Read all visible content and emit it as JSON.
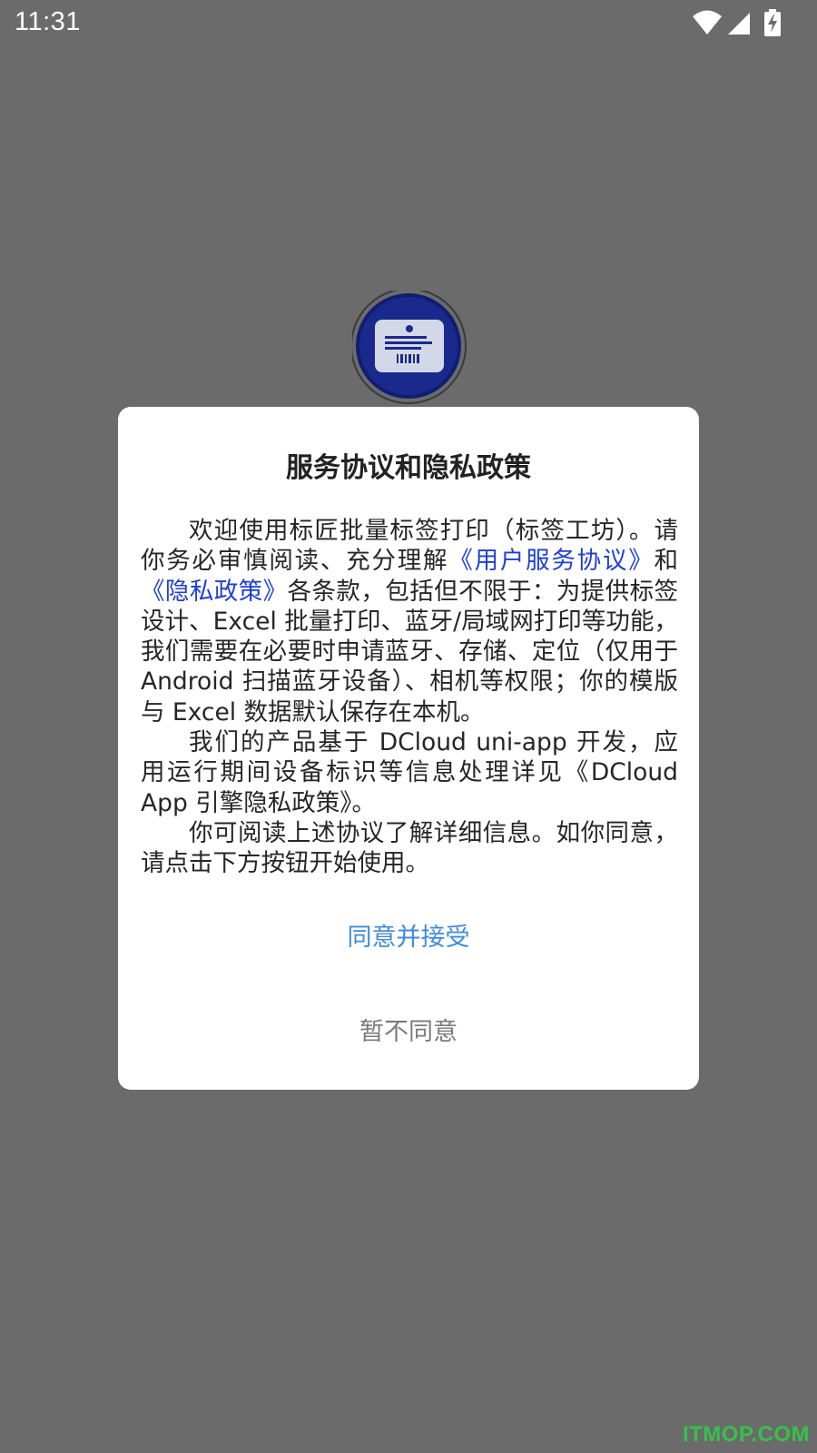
{
  "status_bar": {
    "time": "11:31",
    "icons": [
      "wifi-icon",
      "cell-signal-icon",
      "battery-charging-icon"
    ]
  },
  "app_logo": {
    "icon": "barcode-label-icon",
    "colors": {
      "ring": "#1a2a8c",
      "card": "#cfd5e6"
    }
  },
  "dialog": {
    "title": "服务协议和隐私政策",
    "paragraph1": {
      "text1": "欢迎使用标匠批量标签打印（标签工坊）。请你务必审慎阅读、充分理解",
      "link1": "《用户服务协议》",
      "text2": "和",
      "link2": "《隐私政策》",
      "text3": "各条款，包括但不限于：为提供标签设计、Excel 批量打印、蓝牙/局域网打印等功能，我们需要在必要时申请蓝牙、存储、定位（仅用于 Android 扫描蓝牙设备）、相机等权限；你的模版与 Excel 数据默认保存在本机。"
    },
    "paragraph2": "我们的产品基于 DCloud uni-app 开发，应用运行期间设备标识等信息处理详见《DCloud App 引擎隐私政策》。",
    "paragraph3": "你可阅读上述协议了解详细信息。如你同意，请点击下方按钮开始使用。",
    "agree_label": "同意并接受",
    "disagree_label": "暂不同意",
    "colors": {
      "link": "#1e3fd8",
      "agree": "#3d8ae3",
      "disagree": "#7b7b7b"
    }
  },
  "watermark": "ITMOP.COM"
}
